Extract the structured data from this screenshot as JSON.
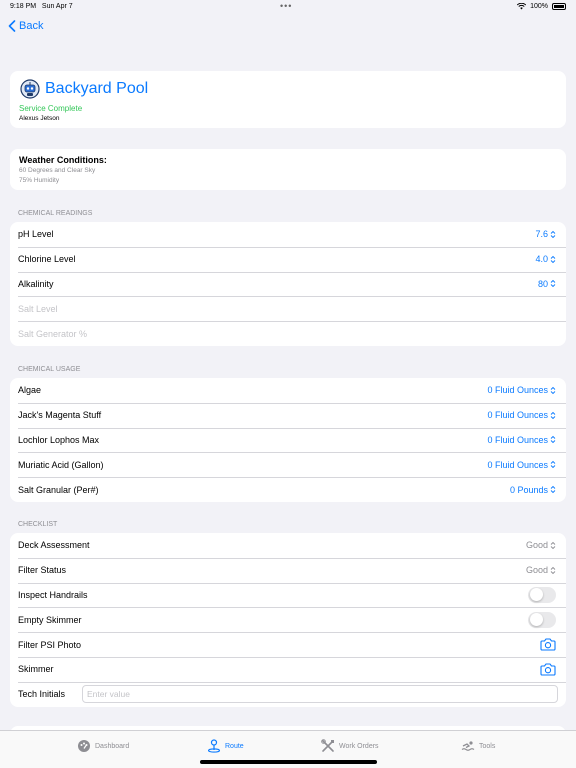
{
  "status_bar": {
    "time": "9:18 PM",
    "date": "Sun Apr 7",
    "battery": "100%"
  },
  "nav": {
    "back_label": "Back"
  },
  "header": {
    "title": "Backyard Pool",
    "status": "Service Complete",
    "technician": "Alexus Jetson",
    "status_color": "#34c759"
  },
  "weather": {
    "title": "Weather Conditions:",
    "line1": "60 Degrees and Clear Sky",
    "line2": "75% Humidity"
  },
  "chemical_readings": {
    "label": "CHEMICAL READINGS",
    "rows": [
      {
        "label": "pH Level",
        "value": "7.6"
      },
      {
        "label": "Chlorine Level",
        "value": "4.0"
      },
      {
        "label": "Alkalinity",
        "value": "80"
      },
      {
        "label": "Salt Level",
        "value": ""
      },
      {
        "label": "Salt Generator %",
        "value": ""
      }
    ]
  },
  "chemical_usage": {
    "label": "CHEMICAL USAGE",
    "rows": [
      {
        "label": "Algae",
        "value": "0 Fluid Ounces"
      },
      {
        "label": "Jack's Magenta Stuff",
        "value": "0 Fluid Ounces"
      },
      {
        "label": "Lochlor Lophos Max",
        "value": "0 Fluid Ounces"
      },
      {
        "label": "Muriatic Acid (Gallon)",
        "value": "0 Fluid Ounces"
      },
      {
        "label": "Salt Granular (Per#)",
        "value": "0 Pounds"
      }
    ]
  },
  "checklist": {
    "label": "CHECKLIST",
    "rows": [
      {
        "label": "Deck Assessment",
        "value": "Good"
      },
      {
        "label": "Filter Status",
        "value": "Good"
      },
      {
        "label": "Inspect Handrails",
        "toggle": false
      },
      {
        "label": "Empty Skimmer",
        "toggle": false
      },
      {
        "label": "Filter PSI Photo",
        "icon": "camera-icon"
      },
      {
        "label": "Skimmer",
        "icon": "camera-icon"
      },
      {
        "label": "Tech Initials",
        "placeholder": "Enter value"
      }
    ]
  },
  "tabbar": {
    "tabs": [
      {
        "label": "Dashboard",
        "icon": "dashboard-icon",
        "active": false
      },
      {
        "label": "Route",
        "icon": "route-icon",
        "active": true
      },
      {
        "label": "Work Orders",
        "icon": "tools-crossed-icon",
        "active": false
      },
      {
        "label": "Tools",
        "icon": "swimmer-icon",
        "active": false
      }
    ]
  },
  "colors": {
    "accent": "#0a7aff",
    "background": "#f2f2f7",
    "success": "#34c759"
  }
}
